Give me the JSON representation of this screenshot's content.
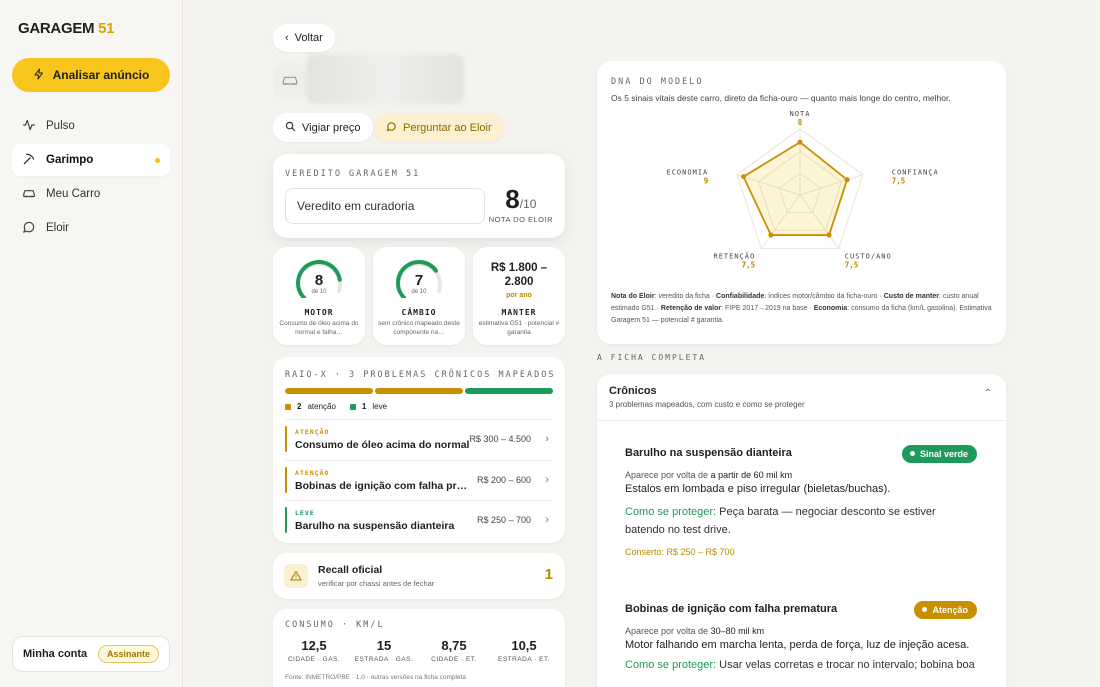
{
  "sidebar": {
    "logo_text": "GARAGEM",
    "logo_num": "51",
    "analyze_label": "Analisar anúncio",
    "items": [
      {
        "label": "Pulso"
      },
      {
        "label": "Garimpo"
      },
      {
        "label": "Meu Carro"
      },
      {
        "label": "Eloir"
      }
    ],
    "account_label": "Minha conta",
    "account_badge": "Assinante"
  },
  "toolbar": {
    "back_label": "Voltar",
    "watch_price_label": "Vigiar preço",
    "ask_eloir_label": "Perguntar ao Eloir"
  },
  "verdict": {
    "header": "VEREDITO GARAGEM 51",
    "text": "Veredito em curadoria",
    "score": "8",
    "score_den": "/10",
    "score_label": "NOTA DO ELOIR"
  },
  "mini_cards": {
    "motor": {
      "value": "8",
      "den": "de 10",
      "title": "MOTOR",
      "desc": "Consumo de óleo acima do normal e falha…",
      "fraction": 0.8
    },
    "cambio": {
      "value": "7",
      "den": "de 10",
      "title": "CÂMBIO",
      "desc": "sem crônico mapeado deste componente na…",
      "fraction": 0.7
    },
    "manter": {
      "value": "R$ 1.800 – 2.800",
      "sub": "por ano",
      "title": "MANTER",
      "desc": "estimativa G51 · potencial # garantia"
    }
  },
  "raiox": {
    "header": "RAIO-X · 3 PROBLEMAS CRÔNICOS MAPEADOS",
    "legend_attention_count": "2",
    "legend_attention": "atenção",
    "legend_light_count": "1",
    "legend_light": "leve",
    "issues": [
      {
        "severity": "ATENÇÃO",
        "name": "Consumo de óleo acima do normal",
        "cost": "R$ 300 – 4.500"
      },
      {
        "severity": "ATENÇÃO",
        "name": "Bobinas de ignição com falha prematura",
        "cost": "R$ 200 – 600"
      },
      {
        "severity": "LEVE",
        "name": "Barulho na suspensão dianteira",
        "cost": "R$ 250 – 700"
      }
    ]
  },
  "recall": {
    "title": "Recall oficial",
    "sub": "verificar por chassi antes de fechar",
    "count": "1"
  },
  "consumo": {
    "header": "CONSUMO · KM/L",
    "values": [
      {
        "value": "12,5",
        "label": "CIDADE · GAS."
      },
      {
        "value": "15",
        "label": "ESTRADA · GAS."
      },
      {
        "value": "8,75",
        "label": "CIDADE · ET."
      },
      {
        "value": "10,5",
        "label": "ESTRADA · ET."
      }
    ],
    "footer": "Fonte: INMETRO/PBE · 1.0 · outras versões na ficha completa"
  },
  "dna": {
    "header": "DNA DO MODELO",
    "sub": "Os 5 sinais vitais deste carro, direto da ficha-ouro — quanto mais longe do centro, melhor.",
    "axes": [
      {
        "label": "NOTA",
        "value": "8",
        "score": 8
      },
      {
        "label": "CONFIANÇA",
        "value": "7,5",
        "score": 7.5
      },
      {
        "label": "CUSTO/ANO",
        "value": "7,5",
        "score": 7.5
      },
      {
        "label": "RETENÇÃO",
        "value": "7,5",
        "score": 7.5
      },
      {
        "label": "ECONOMIA",
        "value": "9",
        "score": 9
      }
    ],
    "note_parts": [
      {
        "b": "Nota do Eloir",
        "t": ": veredito da ficha · "
      },
      {
        "b": "Confiabilidade",
        "t": ": índices motor/câmbio da ficha-ouro · "
      },
      {
        "b": "Custo de manter",
        "t": ": custo anual estimado G51 · "
      },
      {
        "b": "Retenção de valor",
        "t": ": FIPE 2017→2019 na base · "
      },
      {
        "b": "Economia",
        "t": ": consumo da ficha (km/L gasolina). Estimativa Garagem 51 — potencial # garantia."
      }
    ]
  },
  "ficha": {
    "label": "A FICHA COMPLETA",
    "section_title": "Crônicos",
    "section_sub": "3 problemas mapeados, com custo e como se proteger",
    "items": [
      {
        "title": "Barulho na suspensão dianteira",
        "status": "Sinal verde",
        "appears_prefix": "Aparece por volta de ",
        "appears_value": "a partir de 60 mil km",
        "symptoms": "Estalos em lombada e piso irregular (bieletas/buchas).",
        "protect_label": "Como se proteger:",
        "protect_text": " Peça barata — negociar desconto se estiver batendo no test drive.",
        "repair": "Conserto: R$ 250 – R$ 700"
      },
      {
        "title": "Bobinas de ignição com falha prematura",
        "status": "Atenção",
        "appears_prefix": "Aparece por volta de ",
        "appears_value": "30–80 mil km",
        "symptoms": "Motor falhando em marcha lenta, perda de força, luz de injeção acesa.",
        "protect_label": "Como se proteger:",
        "protect_text": " Usar velas corretas e trocar no intervalo; bobina boa"
      }
    ]
  },
  "colors": {
    "accent": "#f7c51b",
    "attention": "#c98f00",
    "ok": "#1e9a5a"
  }
}
